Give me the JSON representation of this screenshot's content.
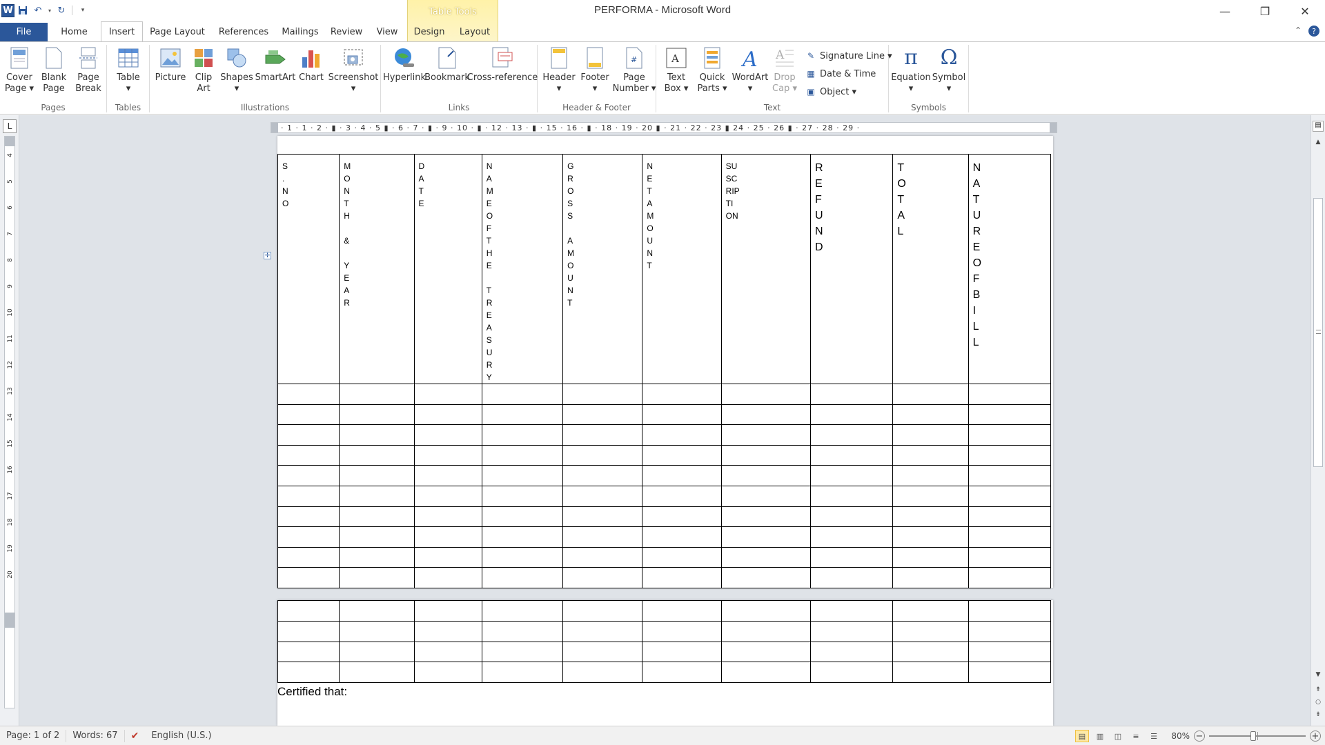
{
  "window": {
    "title": "PERFORMA  -  Microsoft Word",
    "context_tab_caption": "Table Tools",
    "minimize": "—",
    "restore": "❐",
    "close": "✕"
  },
  "tabs": {
    "file": "File",
    "home": "Home",
    "insert": "Insert",
    "page_layout": "Page Layout",
    "references": "References",
    "mailings": "Mailings",
    "review": "Review",
    "view": "View",
    "design": "Design",
    "layout": "Layout"
  },
  "ribbon": {
    "pages": {
      "label": "Pages",
      "cover_page": "Cover\nPage ▾",
      "blank_page": "Blank\nPage",
      "page_break": "Page\nBreak"
    },
    "tables": {
      "label": "Tables",
      "table": "Table\n▾"
    },
    "illustrations": {
      "label": "Illustrations",
      "picture": "Picture",
      "clip_art": "Clip\nArt",
      "shapes": "Shapes\n▾",
      "smartart": "SmartArt",
      "chart": "Chart",
      "screenshot": "Screenshot\n▾"
    },
    "links": {
      "label": "Links",
      "hyperlink": "Hyperlink",
      "bookmark": "Bookmark",
      "cross_reference": "Cross-reference"
    },
    "header_footer": {
      "label": "Header & Footer",
      "header": "Header\n▾",
      "footer": "Footer\n▾",
      "page_number": "Page\nNumber ▾"
    },
    "text": {
      "label": "Text",
      "text_box": "Text\nBox ▾",
      "quick_parts": "Quick\nParts ▾",
      "wordart": "WordArt\n▾",
      "drop_cap": "Drop\nCap ▾",
      "signature_line": "Signature Line ▾",
      "date_time": "Date & Time",
      "object": "Object ▾"
    },
    "symbols": {
      "label": "Symbols",
      "equation": "Equation\n▾",
      "symbol": "Symbol\n▾"
    }
  },
  "ruler": {
    "horizontal": "· 1 · 1 · 2 · ▮ · 3 · 4 · 5 ▮ · 6 · 7 · ▮ · 9 · 10 · ▮ · 12 · 13 · ▮ · 15 · 16 · ▮ · 18 · 19 · 20 ▮ · 21 · 22 · 23 ▮ 24 · 25 · 26 ▮ · 27 · 28 · 29 ·",
    "vertical_numbers": [
      "4",
      "5",
      "6",
      "7",
      "8",
      "9",
      "10",
      "11",
      "12",
      "13",
      "14",
      "15",
      "16",
      "17",
      "18",
      "19",
      "20"
    ],
    "corner": "L"
  },
  "document": {
    "headers": [
      {
        "letters": [
          "S",
          ".",
          "N",
          "O"
        ],
        "size": "small"
      },
      {
        "letters": [
          "M",
          "O",
          "N",
          "T",
          "H",
          "",
          "&",
          "",
          "Y",
          "E",
          "A",
          "R"
        ],
        "size": "small"
      },
      {
        "letters": [
          "D",
          "A",
          "T",
          "E"
        ],
        "size": "small"
      },
      {
        "letters": [
          "N",
          "A",
          "M",
          "E",
          "O",
          "F",
          "T",
          "H",
          "E",
          "",
          "T",
          "R",
          "E",
          "A",
          "S",
          "U",
          "R",
          "Y"
        ],
        "size": "small"
      },
      {
        "letters": [
          "G",
          "R",
          "O",
          "S",
          "S",
          "",
          "A",
          "M",
          "O",
          "U",
          "N",
          "T"
        ],
        "size": "small"
      },
      {
        "letters": [
          "N",
          "E",
          "T",
          "A",
          "M",
          "O",
          "U",
          "N",
          "T"
        ],
        "size": "small"
      },
      {
        "letters": [
          "SU",
          "SC",
          "RIP",
          "TI",
          "ON"
        ],
        "size": "small"
      },
      {
        "letters": [
          "R",
          "E",
          "F",
          "U",
          "N",
          "D"
        ],
        "size": "big"
      },
      {
        "letters": [
          "T",
          "O",
          "T",
          "A",
          "L"
        ],
        "size": "big"
      },
      {
        "letters": [
          "N",
          "A",
          "T",
          "U",
          "R",
          "E",
          "O",
          "F",
          "B",
          "I",
          "L",
          "L"
        ],
        "size": "big"
      }
    ],
    "certified_text": "Certified that:"
  },
  "status": {
    "page": "Page: 1 of 2",
    "words": "Words: 67",
    "language": "English (U.S.)",
    "zoom": "80%",
    "zoom_minus": "−",
    "zoom_plus": "+"
  },
  "colors": {
    "accent": "#2b579a",
    "context_tab": "#fff2a8"
  }
}
